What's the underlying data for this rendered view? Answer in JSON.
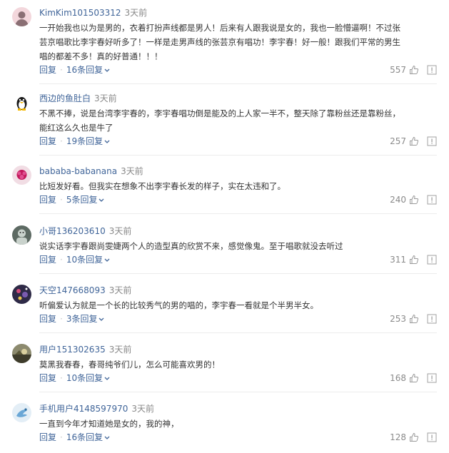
{
  "comments": [
    {
      "user": "KimKim101503312",
      "time": "3天前",
      "lines": [
        "一开始我也以为是男的，衣着打扮声线都是男人！后来有人跟我说是女的，我也一脸懵逼啊！不过张",
        "芸京唱歌比李宇春好听多了！一样是走男声线的张芸京有唱功！李宇春！好一般！跟我们平常的男生",
        "唱的都差不多！真的好普通！！！"
      ],
      "reply_label": "回复",
      "replies_label": "16条回复",
      "likes": "557",
      "avatar": {
        "bg": "#f3d7dc",
        "fg": "#8a6f74"
      }
    },
    {
      "user": "西边的鱼肚白",
      "time": "3天前",
      "lines": [
        "不黑不捧，说是台湾李宇春的，李宇春唱功倒是能及的上人家一半不，整天除了靠粉丝还是靠粉丝，",
        "能红这么久也是牛了"
      ],
      "reply_label": "回复",
      "replies_label": "19条回复",
      "likes": "257",
      "avatar": {
        "bg": "#ffffff",
        "fg": "#1a1a1a"
      }
    },
    {
      "user": "bababa-babanana",
      "time": "3天前",
      "lines": [
        "比短发好看。但我实在想象不出李宇春长发的样子，实在太违和了。"
      ],
      "reply_label": "回复",
      "replies_label": "5条回复",
      "likes": "240",
      "avatar": {
        "bg": "#f1dde4",
        "fg": "#c2185b"
      }
    },
    {
      "user": "小哥136203610",
      "time": "3天前",
      "lines": [
        "说实话李宇春跟尚雯婕两个人的造型真的欣赏不来，感觉像鬼。至于唱歌就没去听过"
      ],
      "reply_label": "回复",
      "replies_label": "10条回复",
      "likes": "311",
      "avatar": {
        "bg": "#5d6a63",
        "fg": "#c9d2cc"
      }
    },
    {
      "user": "天空147668093",
      "time": "3天前",
      "lines": [
        "听偏爱认为就是一个长的比较秀气的男的唱的，李宇春一看就是个半男半女。"
      ],
      "reply_label": "回复",
      "replies_label": "3条回复",
      "likes": "253",
      "avatar": {
        "bg": "#2e2a47",
        "fg": "#d04a7a"
      }
    },
    {
      "user": "用户151302635",
      "time": "3天前",
      "lines": [
        "莫黑我春春，春哥纯爷们儿，怎么可能喜欢男的！"
      ],
      "reply_label": "回复",
      "replies_label": "10条回复",
      "likes": "168",
      "avatar": {
        "bg": "#8c8a6e",
        "fg": "#3e3c2b"
      }
    },
    {
      "user": "手机用户4148597970",
      "time": "3天前",
      "lines": [
        "一直到今年才知道她是女的，我的神，"
      ],
      "reply_label": "回复",
      "replies_label": "16条回复",
      "likes": "128",
      "avatar": {
        "bg": "#e3eef6",
        "fg": "#6aa7d6"
      }
    }
  ],
  "icons": {
    "avatar_default": "avatar-icon",
    "replies_toggle": "chevron-down-icon",
    "like": "thumbs-up-icon",
    "report": "report-icon"
  },
  "colors": {
    "username": "#406599",
    "body_text": "#333333",
    "meta": "#888888",
    "divider": "#ececec"
  }
}
